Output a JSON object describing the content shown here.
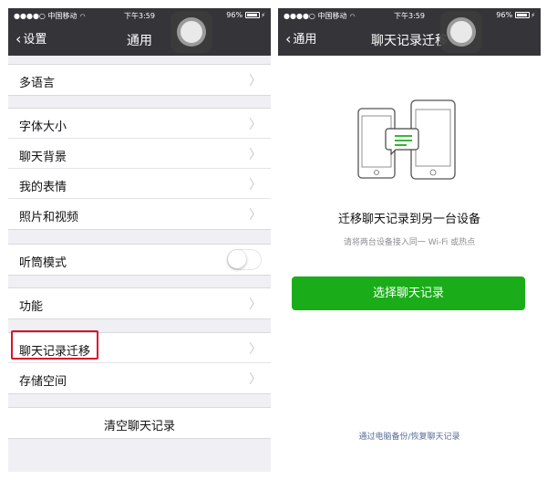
{
  "left_screen": {
    "status": {
      "carrier": "●●●●○ 中国移动",
      "time": "下午3:59",
      "battery": "96%"
    },
    "nav": {
      "back_label": "设置",
      "title": "通用"
    },
    "groups": [
      [
        {
          "label": "多语言"
        }
      ],
      [
        {
          "label": "字体大小"
        },
        {
          "label": "聊天背景"
        },
        {
          "label": "我的表情"
        },
        {
          "label": "照片和视频"
        }
      ],
      [
        {
          "label": "听筒模式",
          "toggle": false
        }
      ],
      [
        {
          "label": "功能"
        }
      ],
      [
        {
          "label": "聊天记录迁移",
          "highlighted": true
        },
        {
          "label": "存储空间"
        }
      ]
    ],
    "clear_button": "清空聊天记录"
  },
  "right_screen": {
    "status": {
      "carrier": "●●●●○ 中国移动",
      "time": "下午3:59",
      "battery": "96%"
    },
    "nav": {
      "back_label": "通用",
      "title": "聊天记录迁移"
    },
    "heading": "迁移聊天记录到另一台设备",
    "subtext": "请将两台设备接入同一 Wi-Fi 或热点",
    "primary_button": "选择聊天记录",
    "footer_link": "通过电脑备份/恢复聊天记录"
  },
  "colors": {
    "nav_bar": "#353439",
    "grouped_background": "#efeff4",
    "primary_green": "#1aad19",
    "link_blue": "#576b95",
    "highlight_red": "#d8132a"
  },
  "icons": [
    "wifi-icon",
    "battery-icon",
    "back-chevron-icon",
    "chevron-right-icon",
    "assistive-touch-icon",
    "phone-transfer-illustration"
  ]
}
